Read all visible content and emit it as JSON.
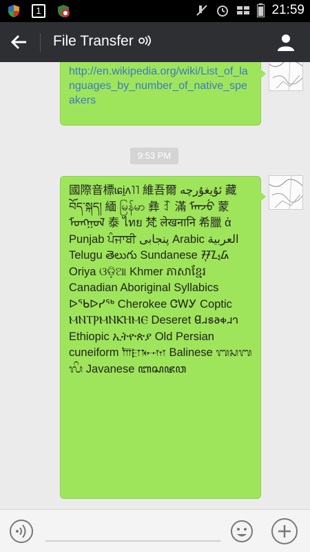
{
  "status_bar": {
    "time": "21:59",
    "left_icons": [
      "shield-icon",
      "notification-count-icon",
      "app-icon"
    ],
    "notification_count": "1",
    "right_icons": [
      "mute-icon",
      "alarm-icon",
      "signal-icon",
      "battery-icon"
    ]
  },
  "app_bar": {
    "title": "File Transfer",
    "back_icon": "back-arrow-icon",
    "contact_icon": "person-icon"
  },
  "messages": [
    {
      "type": "link",
      "text": "http://en.wikipedia.org/wiki/List_of_languages_by_number_of_native_speakers"
    },
    {
      "type": "timestamp",
      "text": "9:53 PM"
    },
    {
      "type": "text",
      "text": "國際音標ɩɕi̯ʌ˥˥ 維吾爾 ئۇيغۇرچە 藏 བོད་སྐད། 緬 မြန်မာ 彝 ꆈ 滿 ᠮᠠᠨᠵᡠ 蒙 ᠮᠣᠩᠭᠣᠯ 泰 ไทย 梵 लेखनानि 希臘 ἀ Punjab ਪੰਜਾਬੀ پنجابی Arabic العربية Telugu తెలుగు Sundanese ᮞᮥᮔ᮪ᮓ Oriya ଓଡ଼ିଆ Khmer ភាសាខ្មែរ Canadian Aboriginal Syllabics ᐅᖃᐅᓯᖅ Cherokee ᏣᎳᎩ Coptic ⲘⲚⲦⲢⲘⲚⲔⲎⲘⲈ Deseret 𐐔𐐯𐑅𐐨𐑉𐐯𐐻 Ethiopic ኢትዮጵያ Old Persian cuneiform 𐎠𐎼𐎹𐎶 Balinese ᬩᬲᬩᬮᬶ Javanese ꦧꦱꦗꦮ"
    }
  ],
  "input_bar": {
    "voice_icon": "voice-icon",
    "emoji_icon": "emoji-icon",
    "plus_icon": "plus-icon"
  }
}
